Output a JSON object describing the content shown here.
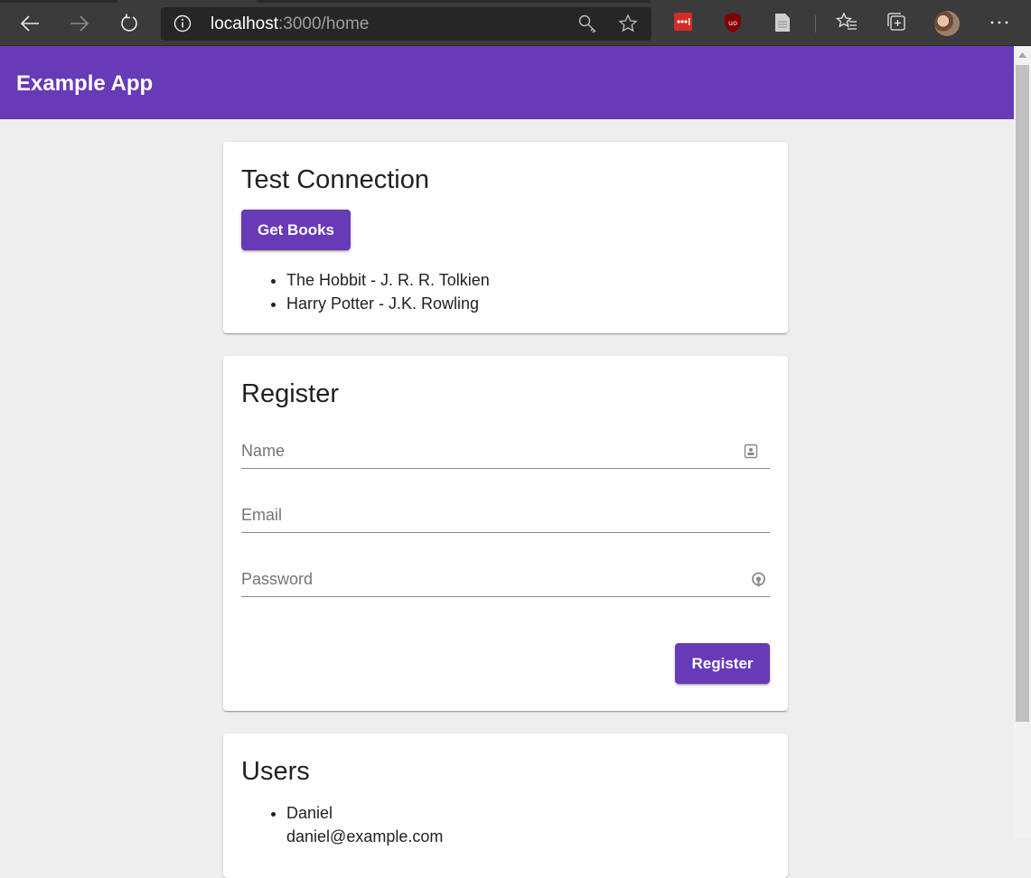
{
  "browser": {
    "url_host": "localhost",
    "url_path": ":3000/home",
    "icons": [
      "back-icon",
      "forward-icon",
      "refresh-icon",
      "info-icon",
      "key-icon",
      "star-icon",
      "lastpass-extension-icon",
      "ublock-extension-icon",
      "reader-extension-icon",
      "favorites-icon",
      "collections-icon",
      "avatar",
      "more-icon"
    ]
  },
  "app": {
    "title": "Example App",
    "accent_color": "#673ab7"
  },
  "test_connection": {
    "title": "Test Connection",
    "button_label": "Get Books",
    "books": [
      "The Hobbit - J. R. R. Tolkien",
      "Harry Potter - J.K. Rowling"
    ]
  },
  "register": {
    "title": "Register",
    "name_placeholder": "Name",
    "email_placeholder": "Email",
    "password_placeholder": "Password",
    "button_label": "Register"
  },
  "users": {
    "title": "Users",
    "items": [
      {
        "name": "Daniel",
        "email": "daniel@example.com"
      }
    ]
  }
}
